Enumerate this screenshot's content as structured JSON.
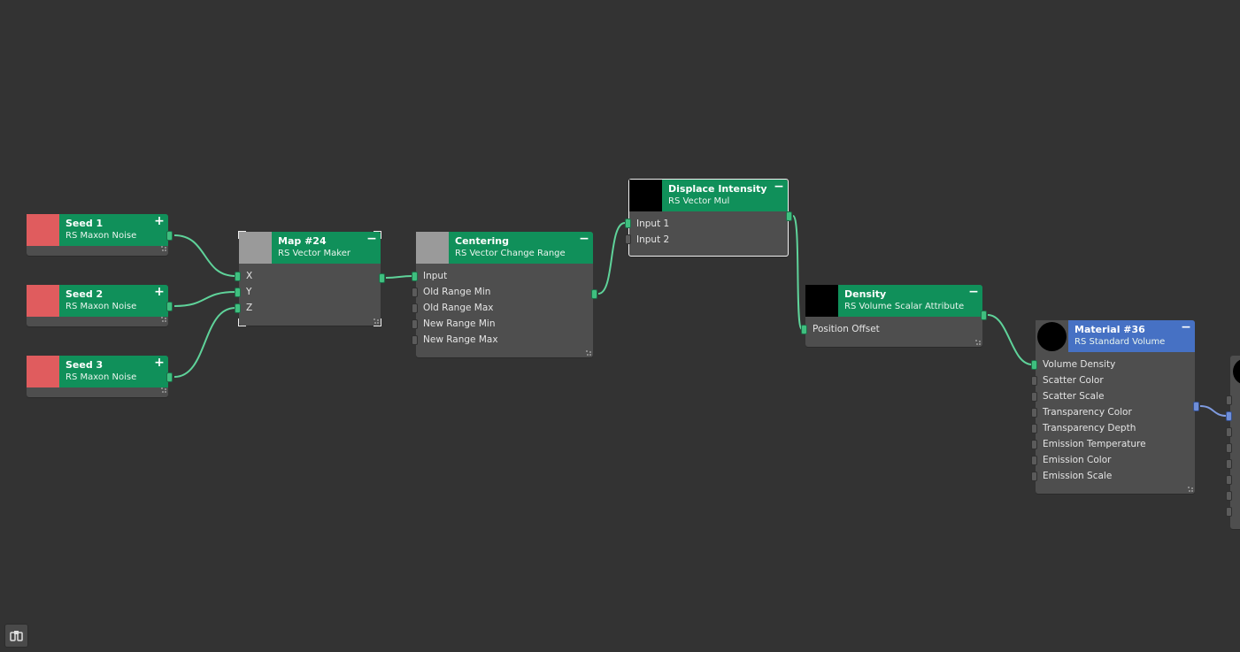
{
  "colors": {
    "background": "#333333",
    "node_body": "#4e4e4e",
    "header_green": "#10905a",
    "header_blue": "#4671c4",
    "wire": "#5fd39a",
    "wire_blue": "#7f9be0",
    "noise_thumb": "#e05c5e",
    "gray_thumb": "#9a9a9a",
    "black_thumb": "#000000"
  },
  "nodes": {
    "seed1": {
      "title": "Seed 1",
      "subtitle": "RS Maxon Noise",
      "toggle": "+",
      "thumb": "noise-swatch"
    },
    "seed2": {
      "title": "Seed 2",
      "subtitle": "RS Maxon Noise",
      "toggle": "+",
      "thumb": "noise-swatch"
    },
    "seed3": {
      "title": "Seed 3",
      "subtitle": "RS Maxon Noise",
      "toggle": "+",
      "thumb": "noise-swatch"
    },
    "map24": {
      "title": "Map #24",
      "subtitle": "RS Vector Maker",
      "toggle": "−",
      "thumb": "gray-swatch",
      "inputs": [
        "X",
        "Y",
        "Z"
      ]
    },
    "centering": {
      "title": "Centering",
      "subtitle": "RS Vector Change Range",
      "toggle": "−",
      "thumb": "gray-swatch",
      "inputs": [
        "Input",
        "Old Range Min",
        "Old Range Max",
        "New Range Min",
        "New Range Max"
      ]
    },
    "displace": {
      "title": "Displace Intensity",
      "subtitle": "RS Vector Mul",
      "toggle": "−",
      "thumb": "black-swatch",
      "inputs": [
        "Input 1",
        "Input 2"
      ]
    },
    "density": {
      "title": "Density",
      "subtitle": "RS Volume Scalar Attribute",
      "toggle": "−",
      "thumb": "black-swatch",
      "inputs": [
        "Position Offset"
      ]
    },
    "material36": {
      "title": "Material #36",
      "subtitle": "RS Standard Volume",
      "toggle": "−",
      "thumb": "sphere-preview",
      "inputs": [
        "Volume Density",
        "Scatter Color",
        "Scatter Scale",
        "Transparency Color",
        "Transparency Depth",
        "Emission Temperature",
        "Emission Color",
        "Emission Scale"
      ]
    }
  },
  "toolbar": {
    "nav_icon": "navigator-icon"
  }
}
